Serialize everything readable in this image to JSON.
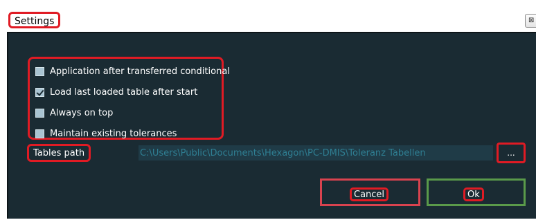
{
  "window": {
    "title": "Settings",
    "close_glyph": "⊠"
  },
  "options": [
    {
      "label": "Application after transferred conditional",
      "checked": false
    },
    {
      "label": "Load last loaded table after start",
      "checked": true
    },
    {
      "label": "Always on top",
      "checked": false
    },
    {
      "label": "Maintain existing tolerances",
      "checked": false
    }
  ],
  "tables_path": {
    "label": "Tables path",
    "value": "C:\\Users\\Public\\Documents\\Hexagon\\PC-DMIS\\Toleranz Tabellen",
    "browse_label": "..."
  },
  "buttons": {
    "cancel": "Cancel",
    "ok": "Ok"
  },
  "colors": {
    "background": "#1a2b33",
    "highlight": "#e01b24",
    "cancel_frame": "#d9434f",
    "ok_frame": "#5a9a4a",
    "path_text": "#2f7f93"
  }
}
